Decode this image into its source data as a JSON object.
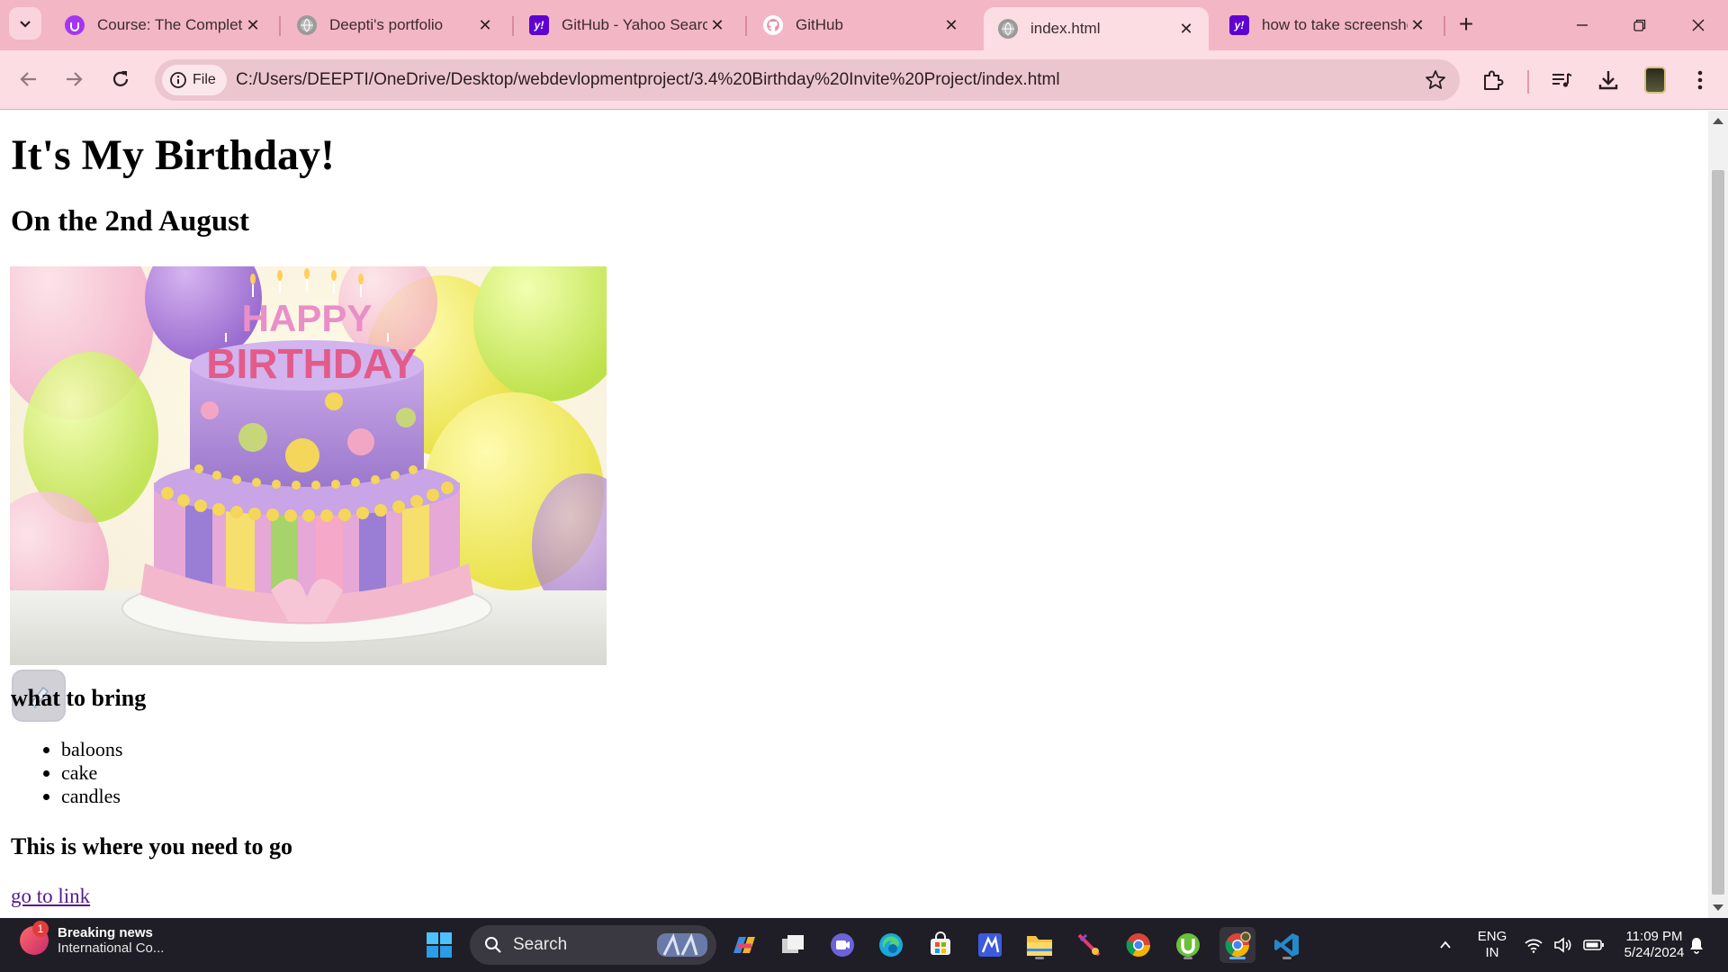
{
  "tabs": [
    {
      "title": "Course: The Complete",
      "favicon": "udemy-icon",
      "color": "#a435f0"
    },
    {
      "title": "Deepti's portfolio",
      "favicon": "globe-icon",
      "color": "#9a9a9a"
    },
    {
      "title": "GitHub - Yahoo Search",
      "favicon": "yahoo-icon",
      "color": "#6001d2"
    },
    {
      "title": "GitHub",
      "favicon": "github-icon",
      "color": "#ffffff"
    },
    {
      "title": "index.html",
      "favicon": "globe-icon",
      "color": "#9a9a9a",
      "active": true
    },
    {
      "title": "how to take screensho",
      "favicon": "yahoo-icon",
      "color": "#6001d2"
    }
  ],
  "toolbar": {
    "chip_label": "File",
    "url": "C:/Users/DEEPTI/OneDrive/Desktop/webdevlopmentproject/3.4%20Birthday%20Invite%20Project/index.html"
  },
  "page": {
    "heading": "It's My Birthday!",
    "subheading": "On the 2nd August",
    "image": {
      "candle_text_1": "HAPPY",
      "candle_text_2": "BIRTHDAY"
    },
    "bring_heading": "what to bring",
    "bring_items": [
      "baloons",
      "cake",
      "candles"
    ],
    "where_heading": "This is where you need to go",
    "link_text": "go to link"
  },
  "taskbar": {
    "news_title": "Breaking news",
    "news_subtitle": "International Co...",
    "news_badge": "1",
    "search_label": "Search",
    "lang_line1": "ENG",
    "lang_line2": "IN",
    "time": "11:09 PM",
    "date": "5/24/2024"
  },
  "colors": {
    "tabstrip": "#f3b6c4",
    "toolbar": "#fbdde3",
    "link": "#551a8b",
    "taskbar": "#1f1d25"
  }
}
